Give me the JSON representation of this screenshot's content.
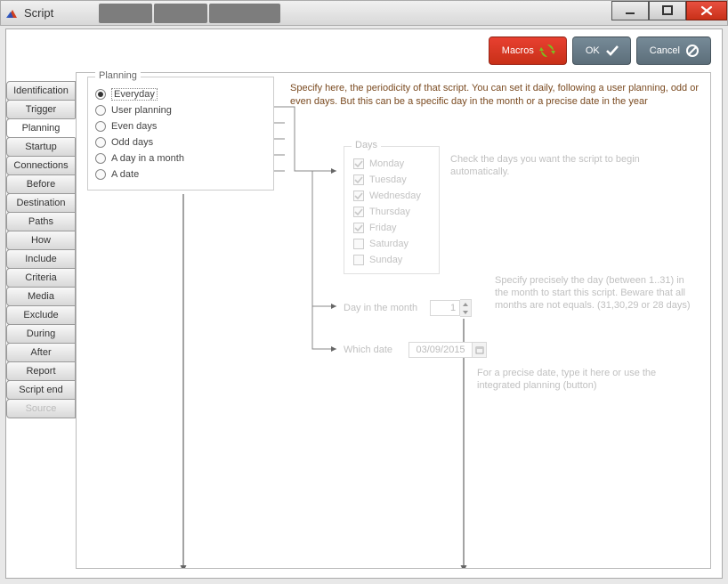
{
  "window": {
    "title": "Script"
  },
  "actions": {
    "macros_label": "Macros",
    "ok_label": "OK",
    "cancel_label": "Cancel"
  },
  "sidetabs": [
    "Identification",
    "Trigger",
    "Planning",
    "Startup",
    "Connections",
    "Before",
    "Destination",
    "Paths",
    "How",
    "Include",
    "Criteria",
    "Media",
    "Exclude",
    "During",
    "After",
    "Report",
    "Script end",
    "Source"
  ],
  "sidetabs_active_index": 2,
  "sidetabs_dim_index": 17,
  "planning": {
    "legend": "Planning",
    "selected_index": 0,
    "options": [
      "Everyday",
      "User planning",
      "Even days",
      "Odd days",
      "A day in a month",
      "A date"
    ]
  },
  "description": "Specify here, the periodicity of that script. You can set it daily, following a user planning, odd or even days. But this can be a specific day in the month or a precise date in the year",
  "days": {
    "legend": "Days",
    "items": [
      {
        "label": "Monday",
        "checked": true
      },
      {
        "label": "Tuesday",
        "checked": true
      },
      {
        "label": "Wednesday",
        "checked": true
      },
      {
        "label": "Thursday",
        "checked": true
      },
      {
        "label": "Friday",
        "checked": true
      },
      {
        "label": "Saturday",
        "checked": false
      },
      {
        "label": "Sunday",
        "checked": false
      }
    ]
  },
  "hint_days": "Check the days you want the script to begin automatically.",
  "day_in_month": {
    "label": "Day in the month",
    "value": "1"
  },
  "hint_dayinmonth": "Specify precisely the day (between 1..31) in the month to start this script. Beware that all months are not equals. (31,30,29 or 28 days)",
  "which_date": {
    "label": "Which date",
    "value": "03/09/2015"
  },
  "hint_whichdate": "For a precise date, type it here or use the integrated planning (button)"
}
